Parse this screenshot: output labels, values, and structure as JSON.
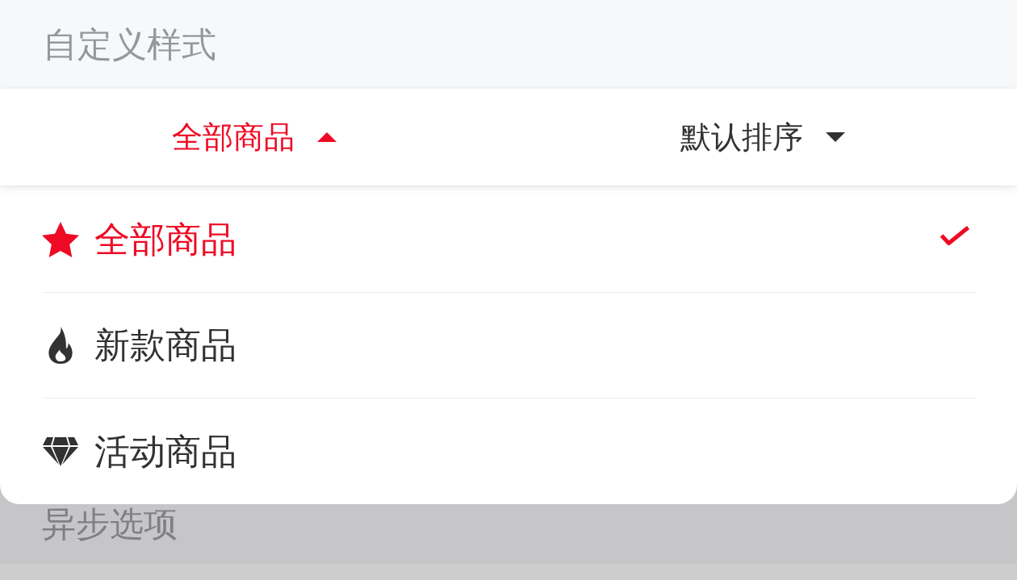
{
  "section_title": "自定义样式",
  "dropdown_menu": {
    "items": [
      {
        "title": "全部商品",
        "expanded": true
      },
      {
        "title": "默认排序",
        "expanded": false
      }
    ]
  },
  "dropdown_options": [
    {
      "label": "全部商品",
      "kind": "star",
      "selected": true
    },
    {
      "label": "新款商品",
      "kind": "fire",
      "selected": false
    },
    {
      "label": "活动商品",
      "kind": "diamond",
      "selected": false
    }
  ],
  "behind_overlay": {
    "section_title": "异步选项"
  }
}
